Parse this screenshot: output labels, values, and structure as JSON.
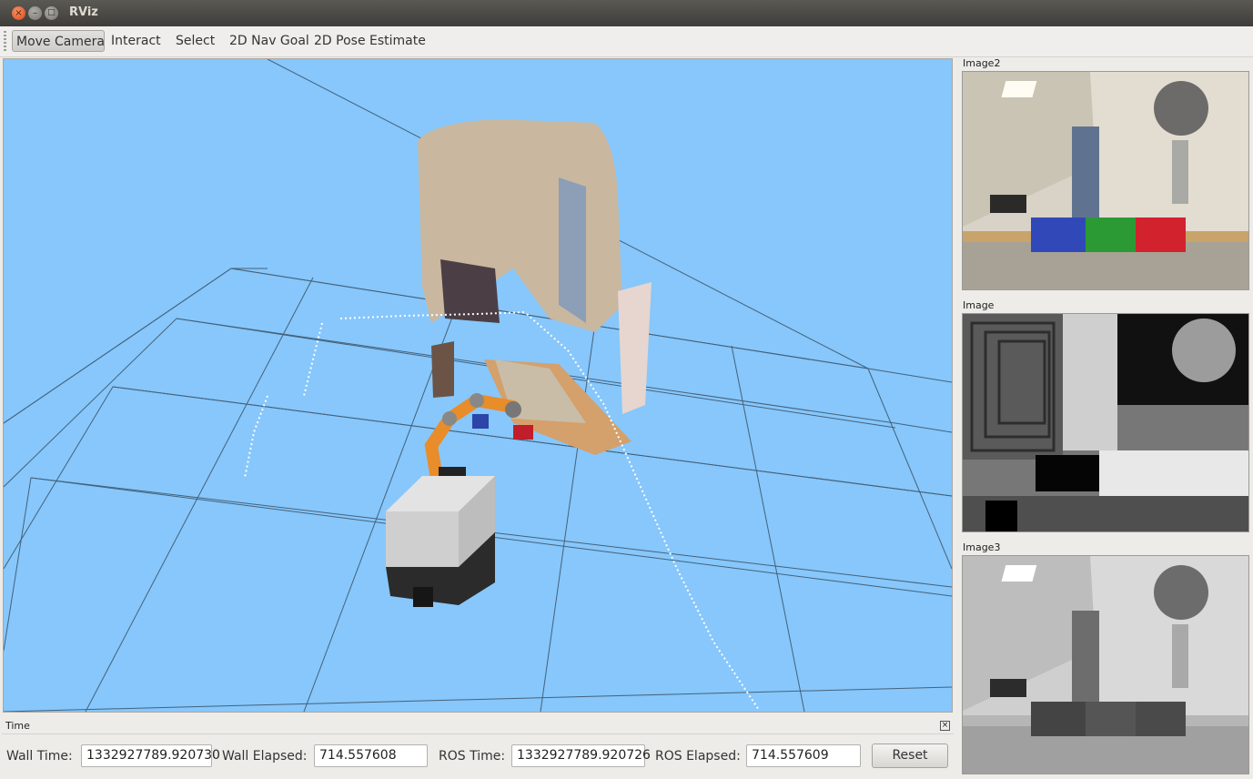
{
  "window": {
    "title": "RViz",
    "close_glyph": "×",
    "minimize_glyph": "–",
    "maximize_glyph": "□"
  },
  "toolbar": {
    "tools": [
      {
        "label": "Move Camera",
        "active": true
      },
      {
        "label": "Interact",
        "active": false
      },
      {
        "label": "Select",
        "active": false
      },
      {
        "label": "2D Nav Goal",
        "active": false
      },
      {
        "label": "2D Pose Estimate",
        "active": false
      }
    ]
  },
  "viewport": {
    "background_color": "#87c7fb",
    "grid_color": "#2f3f50",
    "robot_arm_color": "#e98c2a",
    "laser_scan_color": "#ffffff"
  },
  "image_panels": [
    {
      "label": "Image2",
      "kind": "color camera"
    },
    {
      "label": "Image",
      "kind": "depth image"
    },
    {
      "label": "Image3",
      "kind": "grayscale camera"
    }
  ],
  "time_panel": {
    "title": "Time",
    "close_glyph": "×",
    "wall_time_label": "Wall Time:",
    "wall_time_value": "1332927789.920730",
    "wall_elapsed_label": "Wall Elapsed:",
    "wall_elapsed_value": "714.557608",
    "ros_time_label": "ROS Time:",
    "ros_time_value": "1332927789.920726",
    "ros_elapsed_label": "ROS Elapsed:",
    "ros_elapsed_value": "714.557609",
    "reset_label": "Reset"
  }
}
